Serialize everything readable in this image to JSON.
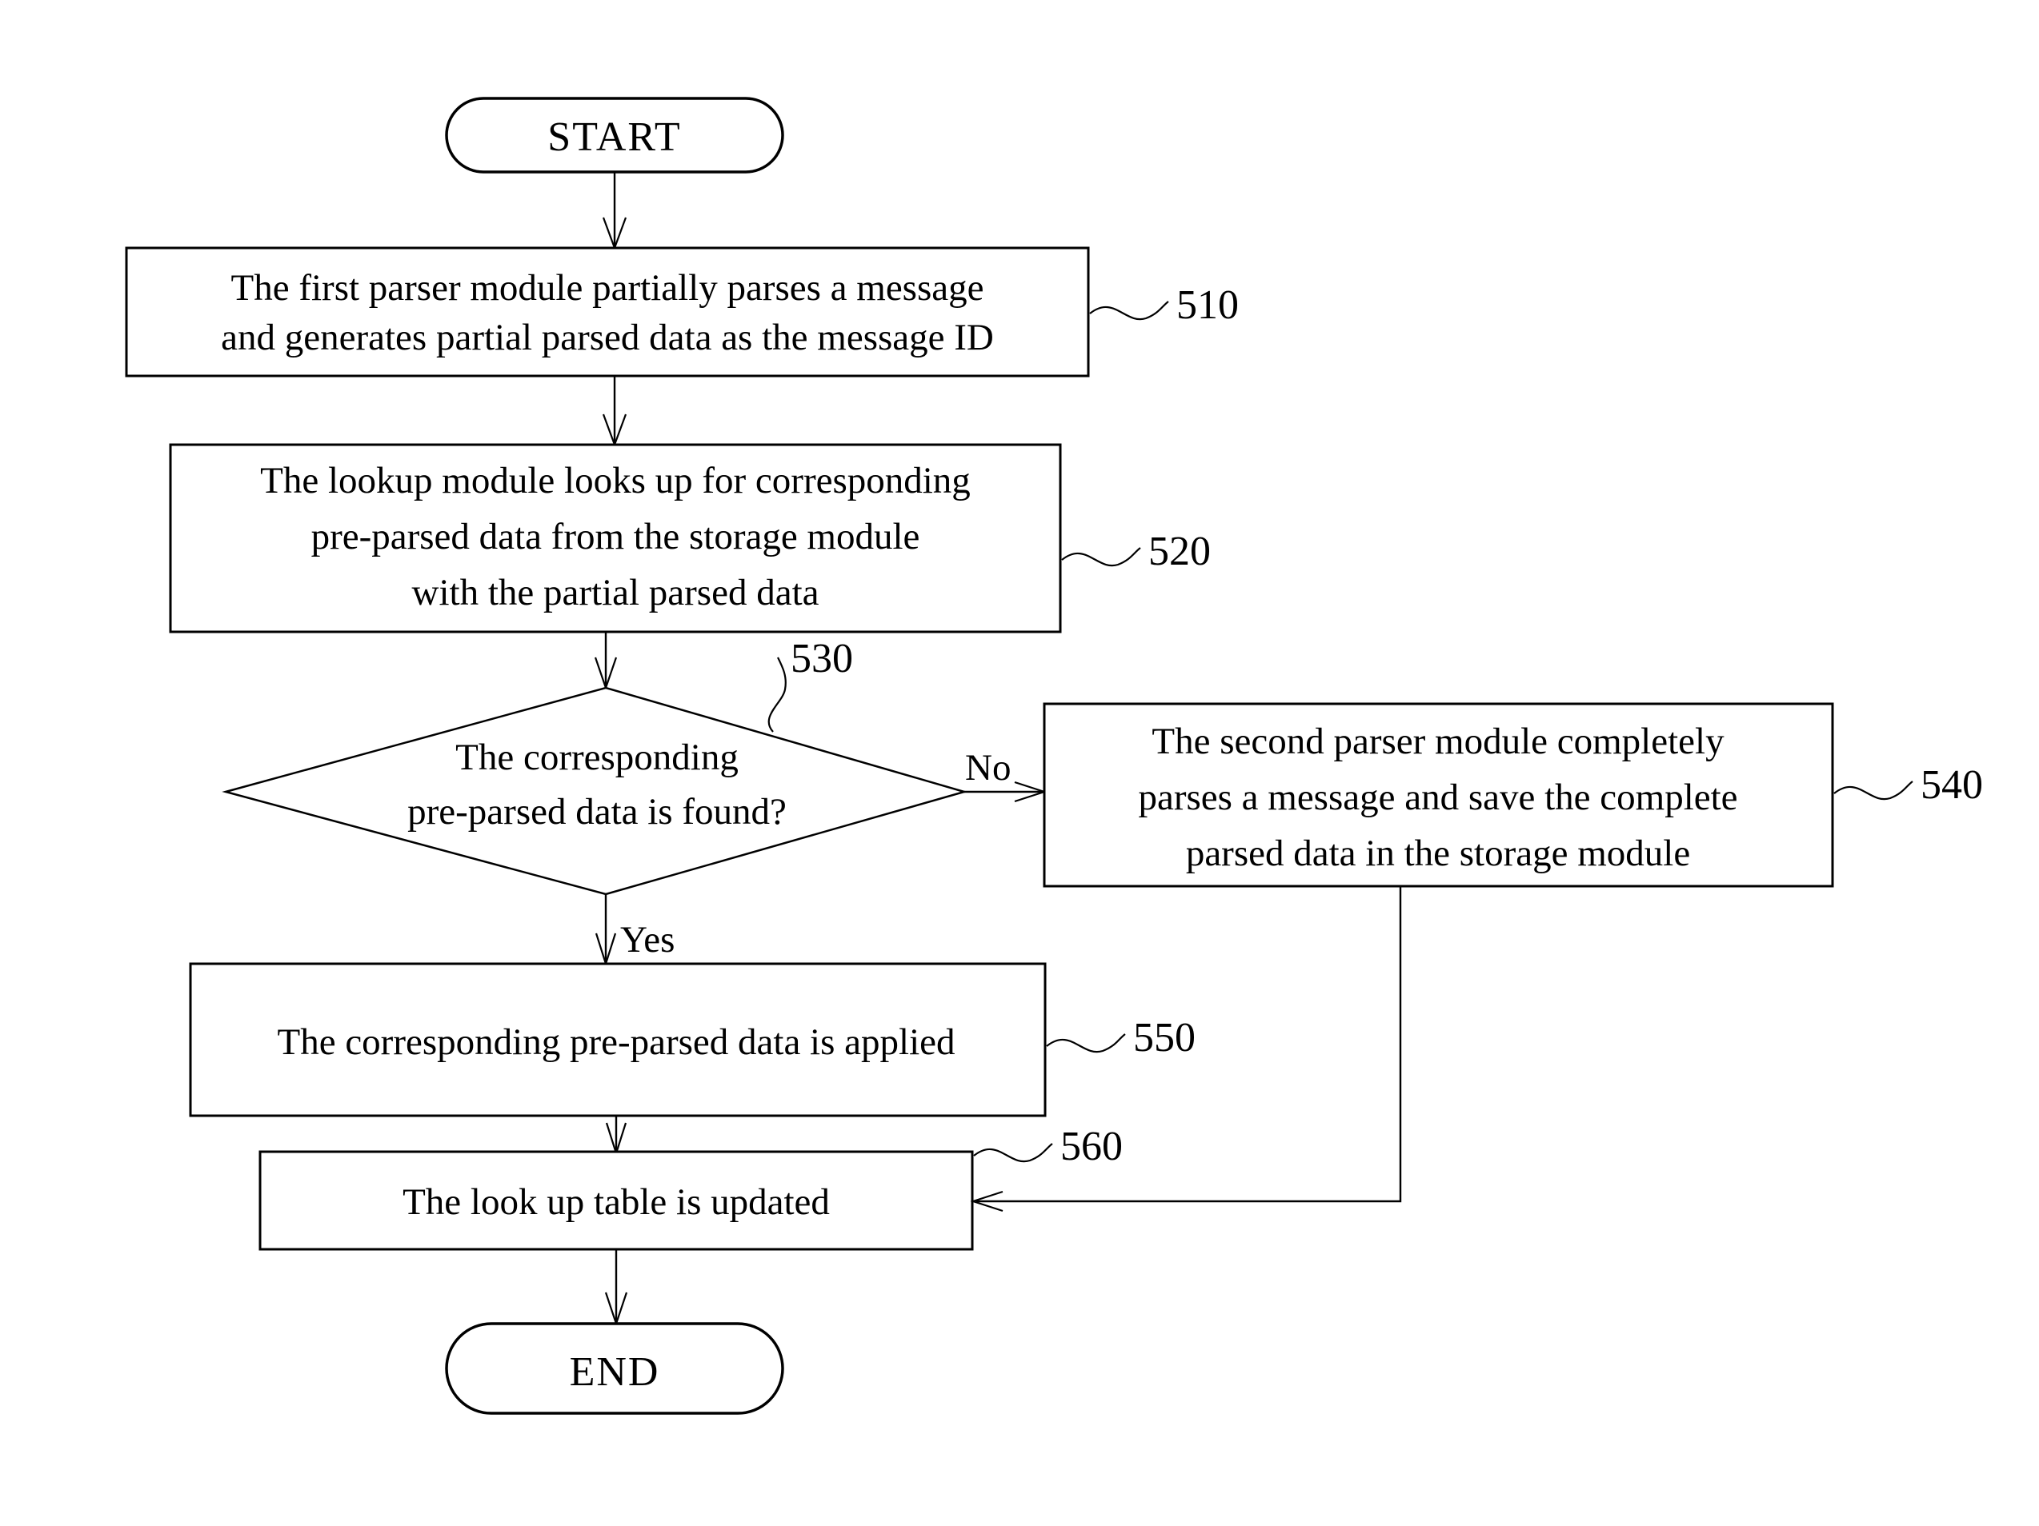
{
  "diagram": {
    "title": "Message parsing flowchart",
    "background_color": "#ffffff",
    "line_color": "#000000"
  },
  "nodes": {
    "start": {
      "shape": "terminator",
      "label": "START"
    },
    "step_510": {
      "shape": "process",
      "ref": "510",
      "lines": [
        "The first parser module partially parses a message",
        "and generates partial parsed data as the message ID"
      ]
    },
    "step_520": {
      "shape": "process",
      "ref": "520",
      "lines": [
        "The lookup module looks up for corresponding",
        "pre-parsed data from the storage module",
        "with the partial parsed data"
      ]
    },
    "decision_530": {
      "shape": "decision",
      "ref": "530",
      "lines": [
        "The corresponding",
        "pre-parsed data is found?"
      ]
    },
    "step_540": {
      "shape": "process",
      "ref": "540",
      "lines": [
        "The second parser module completely",
        "parses a message and save the complete",
        "parsed data in the storage module"
      ]
    },
    "step_550": {
      "shape": "process",
      "ref": "550",
      "lines": [
        "The corresponding pre-parsed data is applied"
      ]
    },
    "step_560": {
      "shape": "process",
      "ref": "560",
      "lines": [
        "The look up table is updated"
      ]
    },
    "end": {
      "shape": "terminator",
      "label": "END"
    }
  },
  "branch_labels": {
    "no": "No",
    "yes": "Yes"
  }
}
